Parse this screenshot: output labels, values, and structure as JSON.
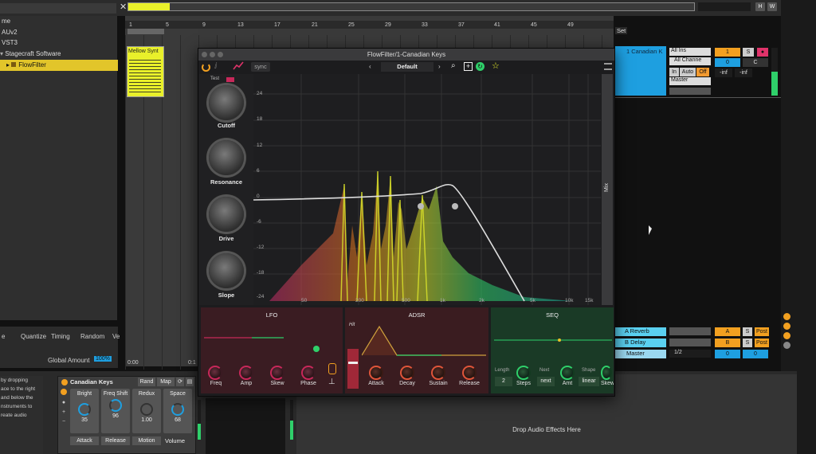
{
  "browser": {
    "items": [
      {
        "label": "me",
        "indent": 0
      },
      {
        "label": "AUv2",
        "indent": 0
      },
      {
        "label": "VST3",
        "indent": 0
      },
      {
        "label": "Stagecraft Software",
        "indent": 1
      },
      {
        "label": "FlowFilter",
        "indent": 2,
        "selected": true
      }
    ],
    "left_hint": [
      "by dropping",
      "ace to the right",
      "and below the",
      "",
      "nstruments to",
      "",
      "reate audio"
    ]
  },
  "ruler": {
    "ticks": [
      "1",
      "5",
      "9",
      "13",
      "17",
      "21",
      "25",
      "29",
      "33",
      "37",
      "41",
      "45",
      "49"
    ],
    "set_label": "Set"
  },
  "clip": {
    "name": "Mellow Synt"
  },
  "arrangement_bottom": {
    "time_left": "0:00",
    "time_right": "0:1"
  },
  "groove": {
    "quantize": "Quantize",
    "timing": "Timing",
    "random": "Random",
    "ve": "Ve",
    "global_amount_label": "Global Amount",
    "global_amount_value": "100%",
    "e_label": "e"
  },
  "track": {
    "name": "1 Canadian K",
    "input_type": "All Ins",
    "input_channel": "All Channe",
    "monitor": [
      "In",
      "Auto",
      "Off"
    ],
    "output": "Master",
    "track_number": "1",
    "solo": "S",
    "volume": "0",
    "pan": "C",
    "meter_left": "-inf",
    "meter_right": "-inf"
  },
  "returns": [
    {
      "name": "A Reverb",
      "letter": "A",
      "solo": "S",
      "post": "Post"
    },
    {
      "name": "B Delay",
      "letter": "B",
      "solo": "S",
      "post": "Post"
    }
  ],
  "master": {
    "name": "Master",
    "cue": "1/2",
    "volume": "0",
    "pan": "0"
  },
  "plugin": {
    "window_title": "FlowFilter/1-Canadian Keys",
    "sync_label": "sync",
    "preset": "Default",
    "test_label": "Test",
    "info": "i",
    "knobs": [
      {
        "label": "Cutoff"
      },
      {
        "label": "Resonance"
      },
      {
        "label": "Drive"
      },
      {
        "label": "Slope"
      }
    ],
    "mix_label": "Mix",
    "db_labels": [
      "24",
      "18",
      "12",
      "6",
      "0",
      "-6",
      "-12",
      "-18",
      "-24"
    ],
    "freq_labels": [
      "50",
      "200",
      "500",
      "1k",
      "2k",
      "5k",
      "10k",
      "15k"
    ],
    "lfo": {
      "title": "LFO",
      "knobs": [
        "Freq",
        "Amp",
        "Skew",
        "Phase"
      ]
    },
    "adsr": {
      "title": "ADSR",
      "hit": "Hit",
      "knobs": [
        "Attack",
        "Decay",
        "Sustain",
        "Release"
      ]
    },
    "seq": {
      "title": "SEQ",
      "length_label": "Length",
      "length_value": "2",
      "steps_label": "Steps",
      "next_top": "Next",
      "next_value": "next",
      "amt_label": "Amt",
      "shape_label": "Shape",
      "shape_value": "linear",
      "skew_label": "Skew"
    }
  },
  "rack": {
    "name": "Canadian Keys",
    "rand": "Rand",
    "map": "Map",
    "macros": [
      {
        "label": "Bright",
        "value": "35"
      },
      {
        "label": "Freq Shift",
        "value": "96"
      },
      {
        "label": "Redux",
        "value": "1.00"
      },
      {
        "label": "Space",
        "value": "68"
      }
    ],
    "volume_label": "Volume",
    "bottom_labels": [
      "Attack",
      "Release",
      "Motion"
    ]
  },
  "drop_effects": "Drop Audio Effects Here",
  "colors": {
    "accent_yellow": "#e9f02a",
    "track_blue": "#1e9fe0",
    "plugin_bg": "#1c1c1e",
    "lfo_bg": "#3a1c22",
    "adsr_bg": "#3a1c20",
    "seq_bg": "#1a3a26"
  }
}
